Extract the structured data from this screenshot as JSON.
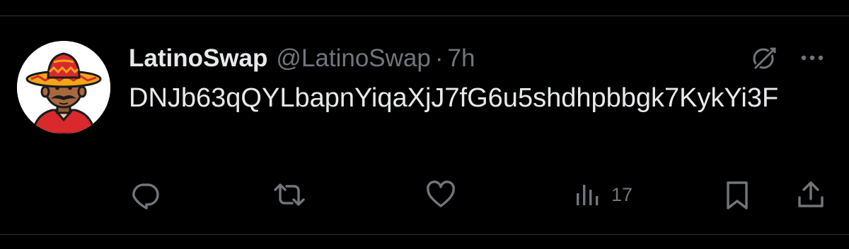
{
  "tweet": {
    "display_name": "LatinoSwap",
    "handle": "@LatinoSwap",
    "separator": "·",
    "time": "7h",
    "text": "DNJb63qQYLbapnYiqaXjJ7fG6u5shdhpbbgk7KykYi3F"
  },
  "header_icons": [
    "grok-icon",
    "more-icon"
  ],
  "actions": {
    "reply": {
      "icon": "reply-icon",
      "count": ""
    },
    "retweet": {
      "icon": "retweet-icon",
      "count": ""
    },
    "like": {
      "icon": "heart-icon",
      "count": ""
    },
    "views": {
      "icon": "views-icon",
      "count": "17"
    },
    "bookmark": {
      "icon": "bookmark-icon",
      "count": ""
    },
    "share": {
      "icon": "share-icon",
      "count": ""
    }
  },
  "colors": {
    "background": "#000000",
    "text_primary": "#e7e9ea",
    "text_secondary": "#71767b",
    "divider": "#2f3336"
  }
}
